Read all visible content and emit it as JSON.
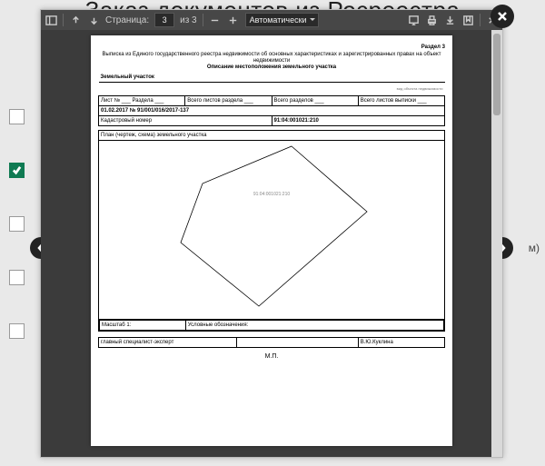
{
  "background": {
    "title": "Заказ документов из Росреестра",
    "right_fragment": "м)",
    "checks": [
      false,
      true,
      false,
      false,
      false
    ]
  },
  "modal": {
    "toolbar": {
      "page_label": "Страница:",
      "page_current": "3",
      "page_of": "из 3",
      "zoom": "Автоматически"
    },
    "doc": {
      "section": "Раздел 3",
      "long_title": "Выписка из Единого государственного реестра недвижимости об основных характеристиках и зарегистрированных правах на объект недвижимости",
      "subtitle": "Описание местоположения земельного участка",
      "object_type": "Земельный участок",
      "row1": {
        "a": "Лист № ___ Раздела ___",
        "b": "Всего листов раздела ___",
        "c": "Всего разделов ___",
        "d": "Всего листов выписки ___"
      },
      "row2": "01.02.2017 № 91/001/016/2017-137",
      "row3": {
        "a": "Кадастровый номер",
        "b": "91:04:001021:210"
      },
      "plan_title": "План (чертеж, схема) земельного участка",
      "plot_label": "91:04:001021:210",
      "row_scale": {
        "a": "Масштаб 1:",
        "b": "Условные обозначения:"
      },
      "row_sign": {
        "a": "главный специалист-эксперт",
        "b": "В.Ю.Куклина"
      },
      "mp": "М.П."
    }
  }
}
